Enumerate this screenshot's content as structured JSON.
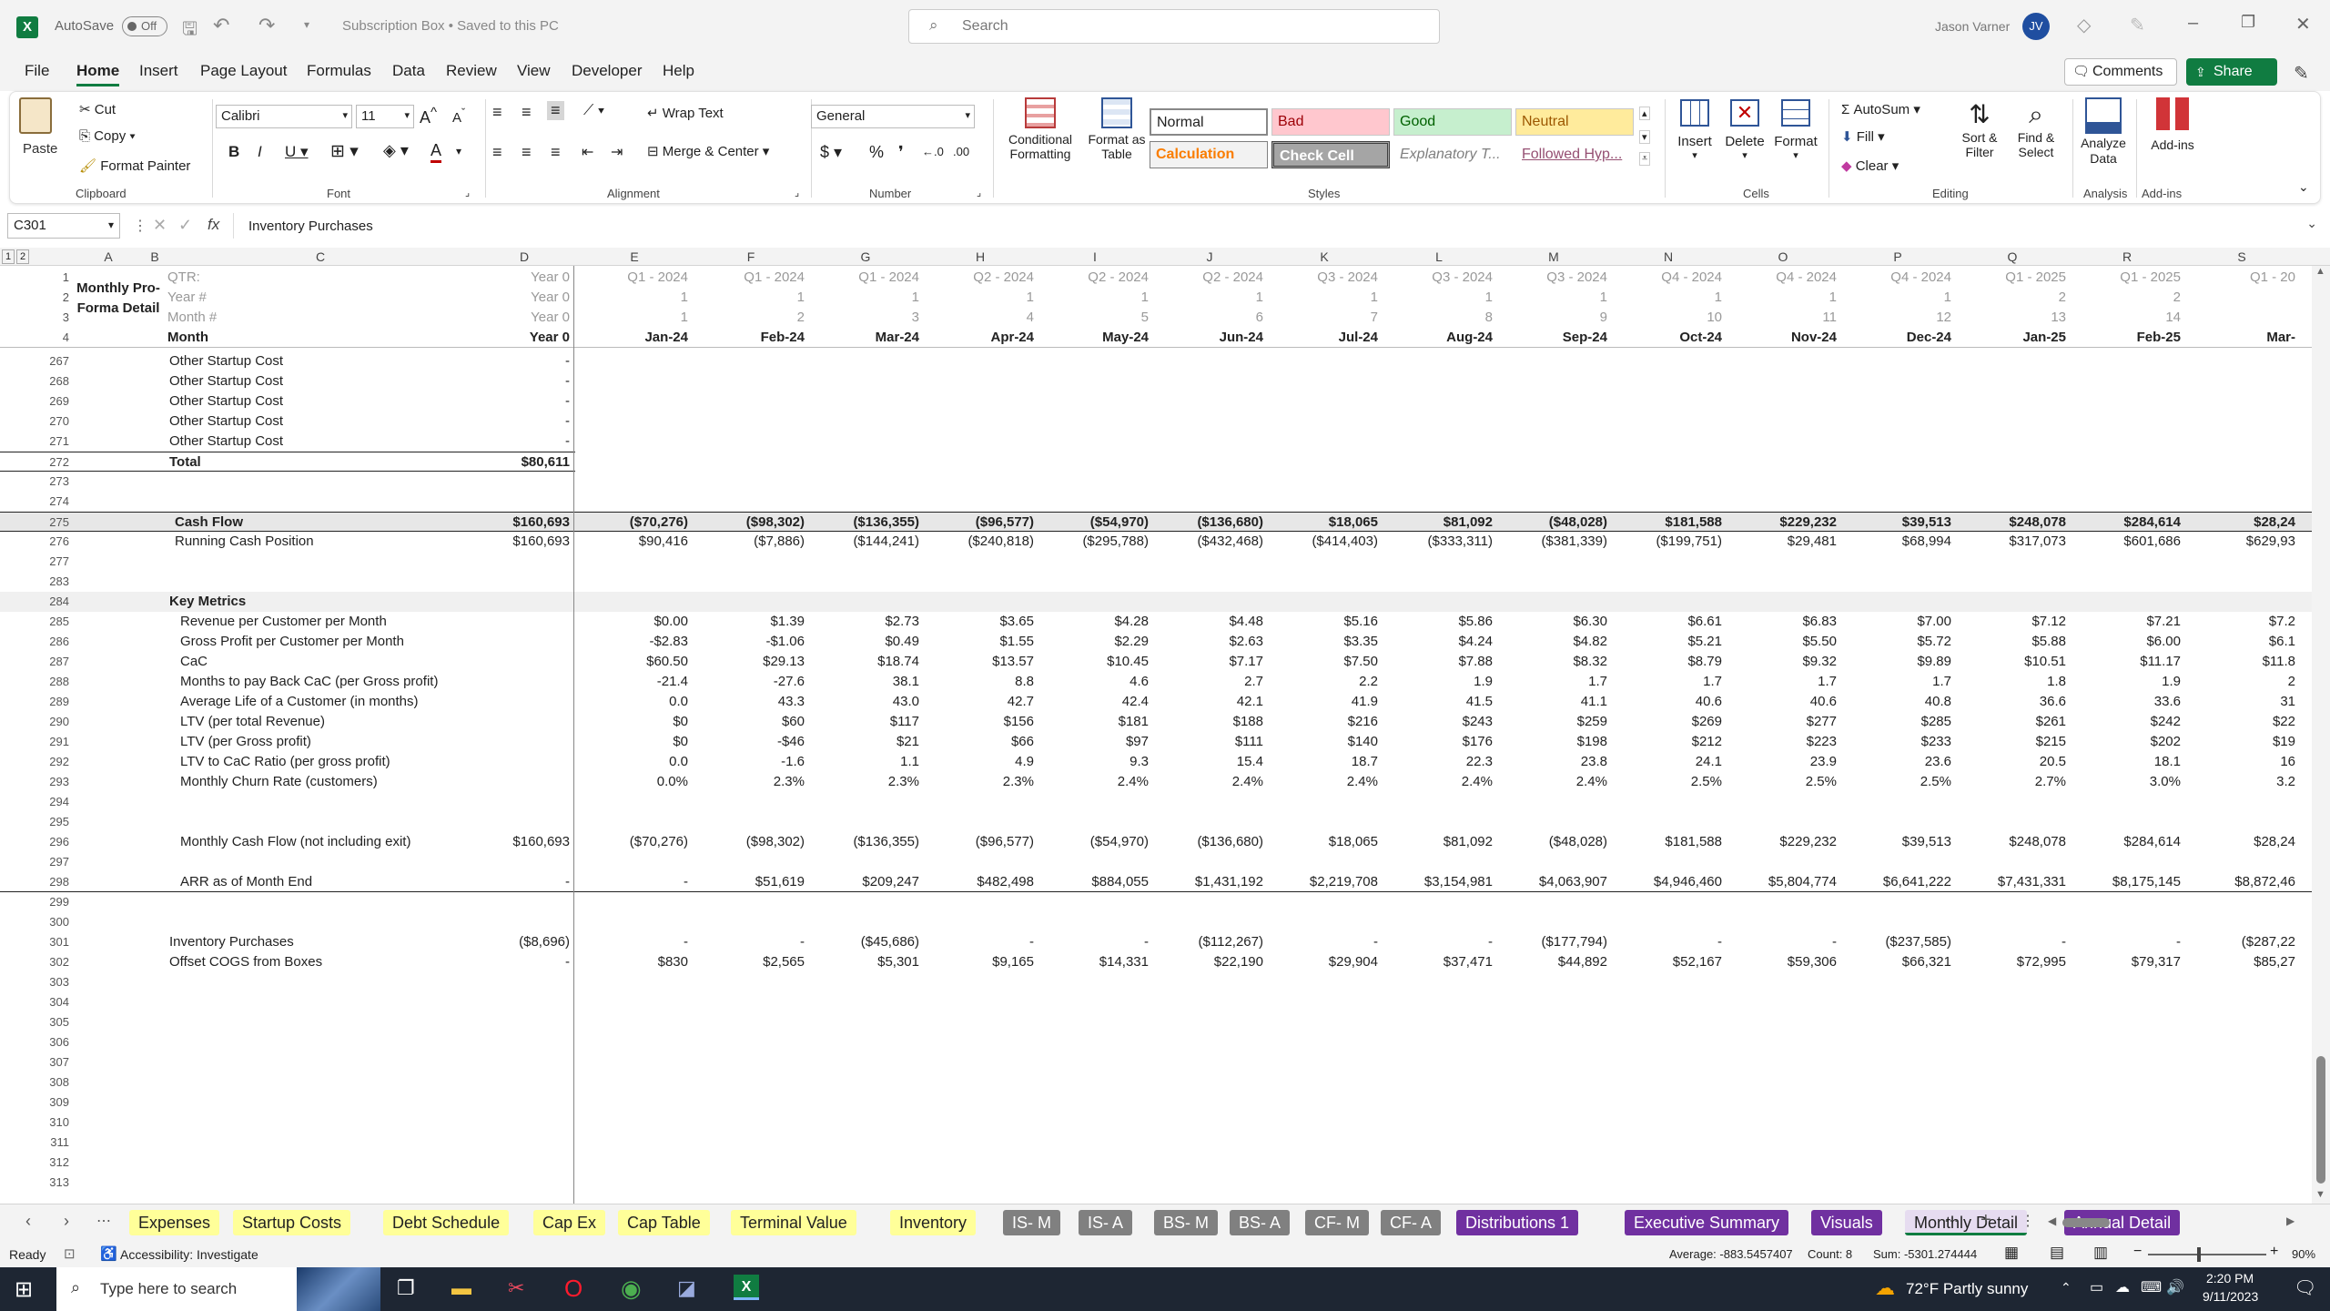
{
  "app": {
    "autosave": "AutoSave",
    "toggle": "Off",
    "doc_title": "Subscription Box • Saved to this PC",
    "search_placeholder": "Search",
    "user": "Jason Varner",
    "initials": "JV"
  },
  "menu": [
    "File",
    "Home",
    "Insert",
    "Page Layout",
    "Formulas",
    "Data",
    "Review",
    "View",
    "Developer",
    "Help"
  ],
  "ribbon": {
    "paste": "Paste",
    "cut": "Cut",
    "copy": "Copy",
    "format_painter": "Format Painter",
    "clipboard": "Clipboard",
    "font_name": "Calibri",
    "font_size": "11",
    "font": "Font",
    "wrap_text": "Wrap Text",
    "merge_center": "Merge & Center",
    "alignment": "Alignment",
    "number_format": "General",
    "number": "Number",
    "cond_format": "Conditional Formatting",
    "format_table": "Format as Table",
    "styles": [
      "Normal",
      "Bad",
      "Good",
      "Neutral",
      "Calculation",
      "Check Cell",
      "Explanatory T...",
      "Followed Hyp..."
    ],
    "styles_label": "Styles",
    "insert": "Insert",
    "delete": "Delete",
    "format": "Format",
    "cells": "Cells",
    "autosum": "AutoSum",
    "fill": "Fill",
    "clear": "Clear",
    "sort_filter": "Sort & Filter",
    "find_select": "Find & Select",
    "editing": "Editing",
    "analyze": "Analyze Data",
    "analysis": "Analysis",
    "addins": "Add-ins",
    "addins_group": "Add-ins",
    "comments": "Comments",
    "share": "Share"
  },
  "formula_bar": {
    "cell": "C301",
    "fx": "fx",
    "content": "Inventory Purchases"
  },
  "columns": [
    "A",
    "B",
    "C",
    "D",
    "E",
    "F",
    "G",
    "H",
    "I",
    "J",
    "K",
    "L",
    "M",
    "N",
    "O",
    "P",
    "Q",
    "R",
    "S"
  ],
  "header_rows": [
    {
      "n": "1",
      "label": "QTR:",
      "d": "Year 0",
      "vals": [
        "Q1 - 2024",
        "Q1 - 2024",
        "Q1 - 2024",
        "Q2 - 2024",
        "Q2 - 2024",
        "Q2 - 2024",
        "Q3 - 2024",
        "Q3 - 2024",
        "Q3 - 2024",
        "Q4 - 2024",
        "Q4 - 2024",
        "Q4 - 2024",
        "Q1 - 2025",
        "Q1 - 2025",
        "Q1 - 20"
      ]
    },
    {
      "n": "2",
      "label": "Year #",
      "d": "Year 0",
      "vals": [
        "1",
        "1",
        "1",
        "1",
        "1",
        "1",
        "1",
        "1",
        "1",
        "1",
        "1",
        "1",
        "2",
        "2",
        ""
      ]
    },
    {
      "n": "3",
      "label": "Month #",
      "d": "Year 0",
      "vals": [
        "1",
        "2",
        "3",
        "4",
        "5",
        "6",
        "7",
        "8",
        "9",
        "10",
        "11",
        "12",
        "13",
        "14",
        ""
      ]
    },
    {
      "n": "4",
      "label": "Month",
      "d": "Year 0",
      "vals": [
        "Jan-24",
        "Feb-24",
        "Mar-24",
        "Apr-24",
        "May-24",
        "Jun-24",
        "Jul-24",
        "Aug-24",
        "Sep-24",
        "Oct-24",
        "Nov-24",
        "Dec-24",
        "Jan-25",
        "Feb-25",
        "Mar-"
      ]
    }
  ],
  "sheet_title": "Monthly Pro-Forma Detail",
  "rows": [
    {
      "n": "267",
      "label": "Other Startup Cost",
      "d": "-",
      "vals": []
    },
    {
      "n": "268",
      "label": "Other Startup Cost",
      "d": "-",
      "vals": []
    },
    {
      "n": "269",
      "label": "Other Startup Cost",
      "d": "-",
      "vals": []
    },
    {
      "n": "270",
      "label": "Other Startup Cost",
      "d": "-",
      "vals": []
    },
    {
      "n": "271",
      "label": "Other Startup Cost",
      "d": "-",
      "vals": []
    },
    {
      "n": "272",
      "label": "Total",
      "d": "$80,611",
      "vals": [],
      "bold": true
    },
    {
      "n": "273",
      "label": "",
      "d": "",
      "vals": []
    },
    {
      "n": "274",
      "label": "",
      "d": "",
      "vals": []
    },
    {
      "n": "275",
      "label": "Cash Flow",
      "d": "$160,693",
      "vals": [
        "($70,276)",
        "($98,302)",
        "($136,355)",
        "($96,577)",
        "($54,970)",
        "($136,680)",
        "$18,065",
        "$81,092",
        "($48,028)",
        "$181,588",
        "$229,232",
        "$39,513",
        "$248,078",
        "$284,614",
        "$28,24"
      ],
      "bold": true
    },
    {
      "n": "276",
      "label": "Running Cash Position",
      "d": "$160,693",
      "vals": [
        "$90,416",
        "($7,886)",
        "($144,241)",
        "($240,818)",
        "($295,788)",
        "($432,468)",
        "($414,403)",
        "($333,311)",
        "($381,339)",
        "($199,751)",
        "$29,481",
        "$68,994",
        "$317,073",
        "$601,686",
        "$629,93"
      ]
    },
    {
      "n": "277",
      "label": "",
      "d": "",
      "vals": []
    },
    {
      "n": "283",
      "label": "",
      "d": "",
      "vals": []
    },
    {
      "n": "284",
      "label": "Key Metrics",
      "d": "",
      "vals": [],
      "bold": true
    },
    {
      "n": "285",
      "label": "Revenue per Customer per Month",
      "d": "",
      "vals": [
        "$0.00",
        "$1.39",
        "$2.73",
        "$3.65",
        "$4.28",
        "$4.48",
        "$5.16",
        "$5.86",
        "$6.30",
        "$6.61",
        "$6.83",
        "$7.00",
        "$7.12",
        "$7.21",
        "$7.2"
      ]
    },
    {
      "n": "286",
      "label": "Gross Profit per Customer per Month",
      "d": "",
      "vals": [
        "-$2.83",
        "-$1.06",
        "$0.49",
        "$1.55",
        "$2.29",
        "$2.63",
        "$3.35",
        "$4.24",
        "$4.82",
        "$5.21",
        "$5.50",
        "$5.72",
        "$5.88",
        "$6.00",
        "$6.1"
      ]
    },
    {
      "n": "287",
      "label": "CaC",
      "d": "",
      "vals": [
        "$60.50",
        "$29.13",
        "$18.74",
        "$13.57",
        "$10.45",
        "$7.17",
        "$7.50",
        "$7.88",
        "$8.32",
        "$8.79",
        "$9.32",
        "$9.89",
        "$10.51",
        "$11.17",
        "$11.8"
      ]
    },
    {
      "n": "288",
      "label": "Months to pay Back CaC (per Gross profit)",
      "d": "",
      "vals": [
        "-21.4",
        "-27.6",
        "38.1",
        "8.8",
        "4.6",
        "2.7",
        "2.2",
        "1.9",
        "1.7",
        "1.7",
        "1.7",
        "1.7",
        "1.8",
        "1.9",
        "2"
      ]
    },
    {
      "n": "289",
      "label": "Average Life of a Customer (in months)",
      "d": "",
      "vals": [
        "0.0",
        "43.3",
        "43.0",
        "42.7",
        "42.4",
        "42.1",
        "41.9",
        "41.5",
        "41.1",
        "40.6",
        "40.6",
        "40.8",
        "36.6",
        "33.6",
        "31"
      ]
    },
    {
      "n": "290",
      "label": "LTV (per total Revenue)",
      "d": "",
      "vals": [
        "$0",
        "$60",
        "$117",
        "$156",
        "$181",
        "$188",
        "$216",
        "$243",
        "$259",
        "$269",
        "$277",
        "$285",
        "$261",
        "$242",
        "$22"
      ]
    },
    {
      "n": "291",
      "label": "LTV (per Gross profit)",
      "d": "",
      "vals": [
        "$0",
        "-$46",
        "$21",
        "$66",
        "$97",
        "$111",
        "$140",
        "$176",
        "$198",
        "$212",
        "$223",
        "$233",
        "$215",
        "$202",
        "$19"
      ]
    },
    {
      "n": "292",
      "label": "LTV to CaC Ratio (per gross profit)",
      "d": "",
      "vals": [
        "0.0",
        "-1.6",
        "1.1",
        "4.9",
        "9.3",
        "15.4",
        "18.7",
        "22.3",
        "23.8",
        "24.1",
        "23.9",
        "23.6",
        "20.5",
        "18.1",
        "16"
      ]
    },
    {
      "n": "293",
      "label": "Monthly Churn Rate (customers)",
      "d": "",
      "vals": [
        "0.0%",
        "2.3%",
        "2.3%",
        "2.3%",
        "2.4%",
        "2.4%",
        "2.4%",
        "2.4%",
        "2.4%",
        "2.5%",
        "2.5%",
        "2.5%",
        "2.7%",
        "3.0%",
        "3.2"
      ]
    },
    {
      "n": "294",
      "label": "",
      "d": "",
      "vals": []
    },
    {
      "n": "295",
      "label": "",
      "d": "",
      "vals": []
    },
    {
      "n": "296",
      "label": "Monthly Cash Flow (not including exit)",
      "d": "$160,693",
      "vals": [
        "($70,276)",
        "($98,302)",
        "($136,355)",
        "($96,577)",
        "($54,970)",
        "($136,680)",
        "$18,065",
        "$81,092",
        "($48,028)",
        "$181,588",
        "$229,232",
        "$39,513",
        "$248,078",
        "$284,614",
        "$28,24"
      ]
    },
    {
      "n": "297",
      "label": "",
      "d": "",
      "vals": []
    },
    {
      "n": "298",
      "label": "ARR as of Month End",
      "d": "-",
      "vals": [
        "$51,619",
        "$209,247",
        "$482,498",
        "$884,055",
        "$1,431,192",
        "$2,219,708",
        "$3,154,981",
        "$4,063,907",
        "$4,946,460",
        "$5,804,774",
        "$6,641,222",
        "$7,431,331",
        "$8,175,145",
        "$8,872,46"
      ],
      "first_dash": true
    },
    {
      "n": "299",
      "label": "",
      "d": "",
      "vals": []
    },
    {
      "n": "300",
      "label": "",
      "d": "",
      "vals": []
    },
    {
      "n": "301",
      "label": "Inventory Purchases",
      "d": "($8,696)",
      "vals": [
        "-",
        "-",
        "($45,686)",
        "-",
        "-",
        "($112,267)",
        "-",
        "-",
        "($177,794)",
        "-",
        "-",
        "($237,585)",
        "-",
        "-",
        "($287,22"
      ]
    },
    {
      "n": "302",
      "label": "Offset COGS from Boxes",
      "d": "-",
      "vals": [
        "$830",
        "$2,565",
        "$5,301",
        "$9,165",
        "$14,331",
        "$22,190",
        "$29,904",
        "$37,471",
        "$44,892",
        "$52,167",
        "$59,306",
        "$66,321",
        "$72,995",
        "$79,317",
        "$85,27"
      ]
    },
    {
      "n": "303",
      "label": "",
      "d": "",
      "vals": []
    },
    {
      "n": "304",
      "label": "",
      "d": "",
      "vals": []
    },
    {
      "n": "305",
      "label": "",
      "d": "",
      "vals": []
    },
    {
      "n": "306",
      "label": "",
      "d": "",
      "vals": []
    },
    {
      "n": "307",
      "label": "",
      "d": "",
      "vals": []
    },
    {
      "n": "308",
      "label": "",
      "d": "",
      "vals": []
    },
    {
      "n": "309",
      "label": "",
      "d": "",
      "vals": []
    },
    {
      "n": "310",
      "label": "",
      "d": "",
      "vals": []
    },
    {
      "n": "311",
      "label": "",
      "d": "",
      "vals": []
    },
    {
      "n": "312",
      "label": "",
      "d": "",
      "vals": []
    },
    {
      "n": "313",
      "label": "",
      "d": "",
      "vals": []
    }
  ],
  "tabs": [
    {
      "label": "Expenses",
      "bg": "#ffff99",
      "fg": "#222"
    },
    {
      "label": "Startup Costs",
      "bg": "#ffff99",
      "fg": "#222"
    },
    {
      "label": "Debt Schedule",
      "bg": "#ffff99",
      "fg": "#222"
    },
    {
      "label": "Cap Ex",
      "bg": "#ffff99",
      "fg": "#222"
    },
    {
      "label": "Cap Table",
      "bg": "#ffff99",
      "fg": "#222"
    },
    {
      "label": "Terminal Value",
      "bg": "#ffff99",
      "fg": "#222"
    },
    {
      "label": "Inventory",
      "bg": "#ffff99",
      "fg": "#222"
    },
    {
      "label": "IS- M",
      "bg": "#808080",
      "fg": "#fff"
    },
    {
      "label": "IS- A",
      "bg": "#808080",
      "fg": "#fff"
    },
    {
      "label": "BS- M",
      "bg": "#808080",
      "fg": "#fff"
    },
    {
      "label": "BS- A",
      "bg": "#808080",
      "fg": "#fff"
    },
    {
      "label": "CF- M",
      "bg": "#808080",
      "fg": "#fff"
    },
    {
      "label": "CF- A",
      "bg": "#808080",
      "fg": "#fff"
    },
    {
      "label": "Distributions 1",
      "bg": "#7030a0",
      "fg": "#fff"
    },
    {
      "label": "Executive Summary",
      "bg": "#7030a0",
      "fg": "#fff"
    },
    {
      "label": "Visuals",
      "bg": "#7030a0",
      "fg": "#fff"
    },
    {
      "label": "Monthly Detail",
      "bg": "#e6dcf0",
      "fg": "#222"
    },
    {
      "label": "Annual Detail",
      "bg": "#7030a0",
      "fg": "#fff"
    }
  ],
  "status": {
    "ready": "Ready",
    "accessibility": "Accessibility: Investigate",
    "average": "Average: -883.5457407",
    "count": "Count: 8",
    "sum": "Sum: -5301.274444",
    "zoom": "90%"
  },
  "taskbar": {
    "search": "Type here to search",
    "weather": "72°F  Partly sunny",
    "time": "2:20 PM",
    "date": "9/11/2023"
  }
}
